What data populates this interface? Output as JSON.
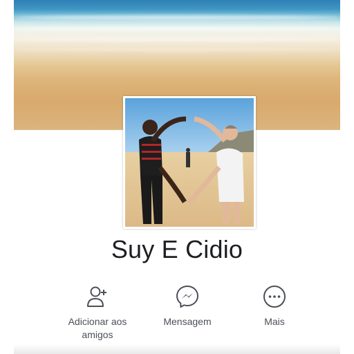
{
  "profile": {
    "name": "Suy E Cidio"
  },
  "actions": [
    {
      "id": "add-friend",
      "icon": "add-friend-icon",
      "label": "Adicionar aos amigos"
    },
    {
      "id": "message",
      "icon": "messenger-icon",
      "label": "Mensagem"
    },
    {
      "id": "more",
      "icon": "more-icon",
      "label": "Mais"
    }
  ],
  "colors": {
    "icon": "#4b4f56",
    "name": "#1c1e21"
  }
}
